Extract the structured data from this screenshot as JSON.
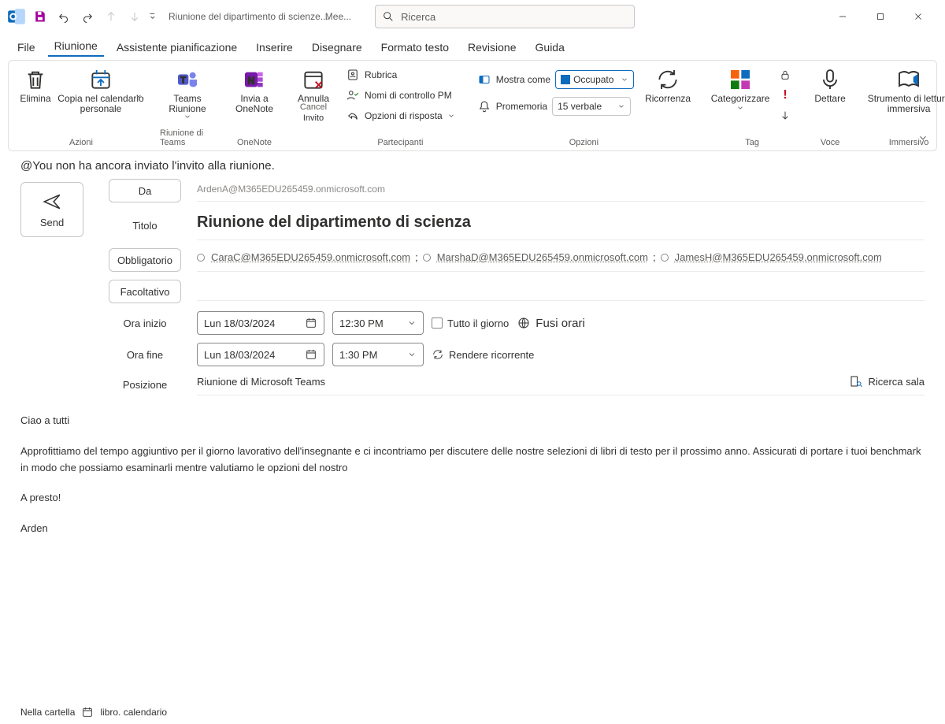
{
  "titlebar": {
    "title": "Riunione del dipartimento di scienze...",
    "overlay": "Mee...",
    "search_placeholder": "Ricerca"
  },
  "tabs": {
    "file": "File",
    "meeting": "Riunione",
    "scheduling": "Assistente pianificazione",
    "insert": "Inserire",
    "draw": "Disegnare",
    "format": "Formato testo",
    "review": "Revisione",
    "help": "Guida"
  },
  "ribbon": {
    "actions": {
      "delete": "Elimina",
      "copy_cal": "Copia nel calendario personale",
      "label": "Azioni"
    },
    "teams": {
      "btn": "Teams Riunione",
      "label": "Riunione di Teams"
    },
    "onenote": {
      "btn": "Invia a OneNote",
      "label": "OneNote"
    },
    "invite": {
      "cancel_top": "Annulla",
      "cancel_sub": "Cancel",
      "sub": "Invito"
    },
    "participants": {
      "addressbook": "Rubrica",
      "checknames": "Nomi di controllo PM",
      "response": "Opzioni di risposta",
      "label": "Partecipanti"
    },
    "options": {
      "showas_lbl": "Mostra come",
      "showas_val": "Occupato",
      "reminder_lbl": "Promemoria",
      "reminder_val": "15 verbale",
      "recurrence": "Ricorrenza",
      "label": "Opzioni"
    },
    "tags": {
      "categorize": "Categorizzare",
      "label": "Tag"
    },
    "voice": {
      "dictate": "Dettare",
      "label": "Voce"
    },
    "immersive": {
      "reader": "Strumento di lettura immersiva",
      "label": "Immersivo"
    }
  },
  "notice": "@You non ha ancora inviato l'invito alla riunione.",
  "form": {
    "send": "Send",
    "from_lbl": "Da",
    "from_val": "ArdenA@M365EDU265459.onmicrosoft.com",
    "title_lbl": "Titolo",
    "title_val": "Riunione del dipartimento di scienza",
    "required_lbl": "Obbligatorio",
    "optional_lbl": "Facoltativo",
    "recipients": [
      "CaraC@M365EDU265459.onmicrosoft.com",
      "MarshaD@M365EDU265459.onmicrosoft.com",
      "JamesH@M365EDU265459.onmicrosoft.com"
    ],
    "start_lbl": "Ora inizio",
    "end_lbl": "Ora fine",
    "start_date": "Lun 18/03/2024",
    "start_time": "12:30 PM",
    "end_date": "Lun 18/03/2024",
    "end_time": "1:30 PM",
    "allday": "Tutto il giorno",
    "timezones": "Fusi orari",
    "make_recurring": "Rendere ricorrente",
    "location_lbl": "Posizione",
    "location_val": "Riunione di Microsoft Teams",
    "room_finder": "Ricerca sala"
  },
  "body": {
    "p1": "Ciao a tutti",
    "p2": "Approfittiamo del tempo aggiuntivo per il giorno lavorativo dell'insegnante e ci incontriamo per discutere delle nostre selezioni di libri di testo per il prossimo anno. Assicurati di portare i tuoi benchmark in modo che possiamo esaminarli mentre valutiamo le opzioni del nostro",
    "p3": "A presto!",
    "p4": "Arden"
  },
  "statusbar": {
    "folder_prefix": "Nella cartella",
    "folder_name": "libro. calendario"
  }
}
